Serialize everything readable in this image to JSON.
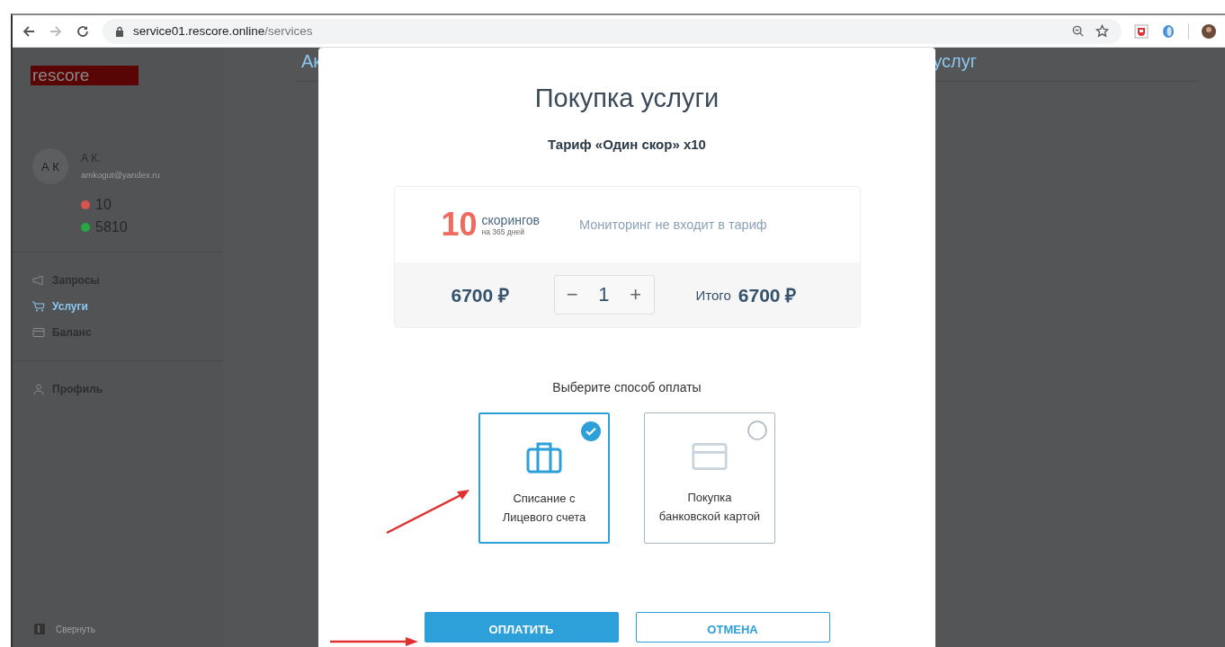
{
  "browser": {
    "url_host": "service01.rescore.online",
    "url_path": "/services"
  },
  "sidebar": {
    "logo": "rescore",
    "user": {
      "initials": "А К",
      "name": "А К.",
      "email": "amkogut@yandex.ru"
    },
    "balances": [
      {
        "value": "10",
        "color": "#d9534f"
      },
      {
        "value": "5810",
        "color": "#27a844"
      }
    ],
    "nav": [
      {
        "label": "Запросы",
        "selected": false
      },
      {
        "label": "Услуги",
        "selected": true
      },
      {
        "label": "Баланс",
        "selected": false
      }
    ],
    "nav2": [
      {
        "label": "Профиль",
        "selected": false
      }
    ],
    "collapse": "Свернуть"
  },
  "page": {
    "heading_left": "Ак",
    "heading_right": "услуг"
  },
  "modal": {
    "title": "Покупка услуги",
    "subtitle": "Тариф «Один скор» х10",
    "count": "10",
    "unit": "скорингов",
    "period": "на 365 дней",
    "note": "Мониторинг не входит в тариф",
    "price": "6700 ₽",
    "quantity": "1",
    "minus": "−",
    "plus": "+",
    "total_label": "Итого",
    "total": "6700 ₽",
    "payment_label": "Выберите способ оплаты",
    "payment_options": [
      {
        "kind": "account",
        "label": "Списание с Лицевого счета",
        "selected": true
      },
      {
        "kind": "card",
        "label": "Покупка банковской картой",
        "selected": false
      }
    ],
    "buttons": [
      {
        "kind": "primary",
        "label": "ОПЛАТИТЬ"
      },
      {
        "kind": "secondary",
        "label": "ОТМЕНА"
      }
    ]
  }
}
